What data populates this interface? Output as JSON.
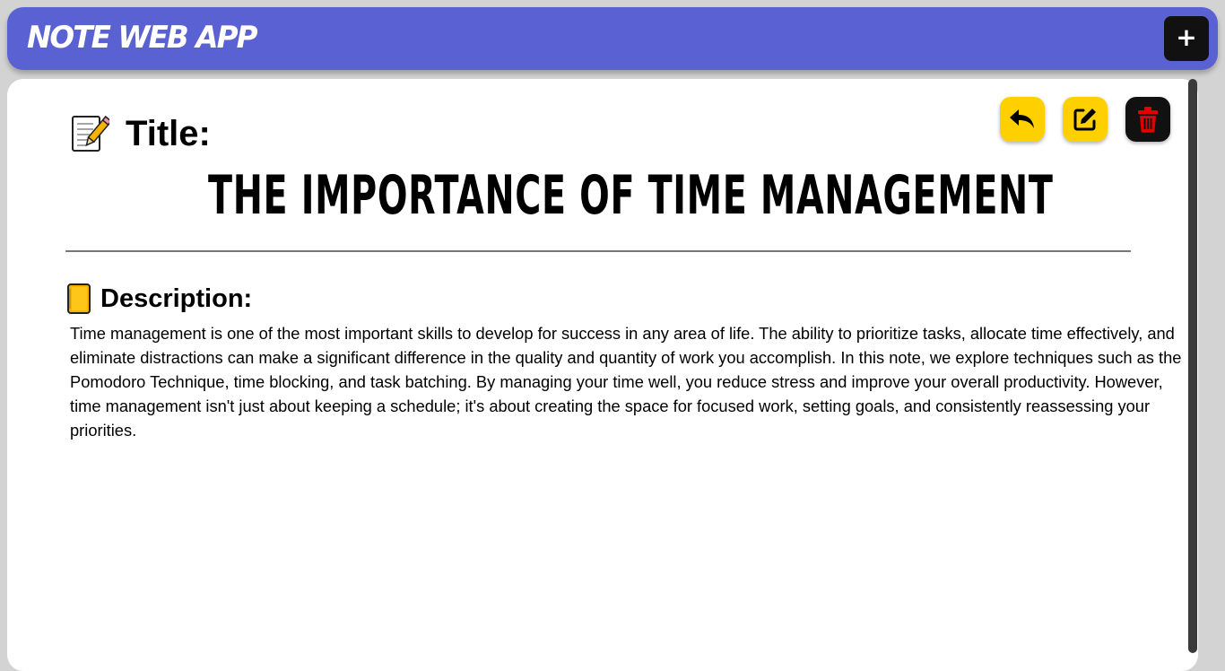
{
  "header": {
    "app_title": "NOTE WEB APP",
    "add_label": "+",
    "add_icon": "plus-icon"
  },
  "actions": {
    "back_icon": "reply-arrow-icon",
    "edit_icon": "edit-square-icon",
    "delete_icon": "trash-icon"
  },
  "note": {
    "title_label": "Title:",
    "title_icon": "memo-emoji-icon",
    "title": "THE IMPORTANCE OF TIME MANAGEMENT",
    "description_label": "Description:",
    "description_icon": "notebook-emoji-icon",
    "description": "Time management is one of the most important skills to develop for success in any area of life. The ability to prioritize tasks, allocate time effectively, and eliminate distractions can make a significant difference in the quality and quantity of work you accomplish. In this note, we explore techniques such as the Pomodoro Technique, time blocking, and task batching. By managing your time well, you reduce stress and improve your overall productivity. However, time management isn't just about keeping a schedule; it's about creating the space for focused work, setting goals, and consistently reassessing your priorities."
  },
  "colors": {
    "navbar": "#5a61d2",
    "page_background": "#d3d3d3",
    "accent_yellow": "#ffd000",
    "delete_red": "#e00000",
    "dark_button": "#111111"
  }
}
